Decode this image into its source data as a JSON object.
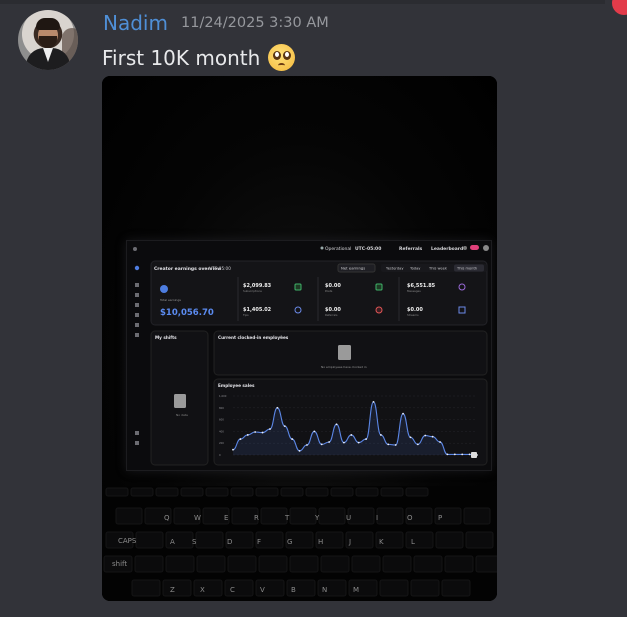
{
  "message": {
    "username": "Nadim",
    "timestamp": "11/24/2025 3:30 AM",
    "text": "First 10K month",
    "emoji": "pleading-face",
    "colors": {
      "username": "#4f8fd6",
      "background": "#323339",
      "text": "#e8e9eb",
      "timestamp": "#96989d"
    }
  },
  "photo": {
    "topbar": {
      "items": [
        "Operational",
        "UTC-05:00",
        "Referrals",
        "Leaderboard"
      ]
    },
    "earnings_card": {
      "title": "Creator earnings overview",
      "timezone": "UTC-05:00",
      "filter": "Net earnings",
      "ranges": [
        "Yesterday",
        "Today",
        "This week",
        "This month"
      ],
      "total_label": "Total earnings",
      "total": "$10,056.70",
      "stats": [
        {
          "value": "$2,099.83",
          "label": "Subscriptions"
        },
        {
          "value": "$0.00",
          "label": "Posts"
        },
        {
          "value": "$6,551.85",
          "label": "Messages"
        },
        {
          "value": "$1,405.02",
          "label": "Tips"
        },
        {
          "value": "$0.00",
          "label": "Referrals"
        },
        {
          "value": "$0.00",
          "label": "Streams"
        }
      ]
    },
    "shifts": {
      "title": "My shifts",
      "empty": "No data"
    },
    "clocked_in": {
      "title": "Current clocked-in employees",
      "count": "0",
      "empty": "No employees have clocked in"
    },
    "chart_data": {
      "type": "line",
      "title": "Employee sales",
      "ylim": [
        0,
        1000
      ],
      "y_ticks": [
        "1,000",
        "800",
        "600",
        "400",
        "200",
        "0"
      ],
      "values": [
        90,
        270,
        340,
        390,
        380,
        440,
        800,
        490,
        270,
        70,
        170,
        400,
        180,
        220,
        520,
        210,
        340,
        210,
        270,
        900,
        340,
        180,
        170,
        700,
        300,
        180,
        330,
        310,
        220,
        10,
        10,
        10,
        10,
        0
      ],
      "line_color": "#5b86e5"
    }
  }
}
